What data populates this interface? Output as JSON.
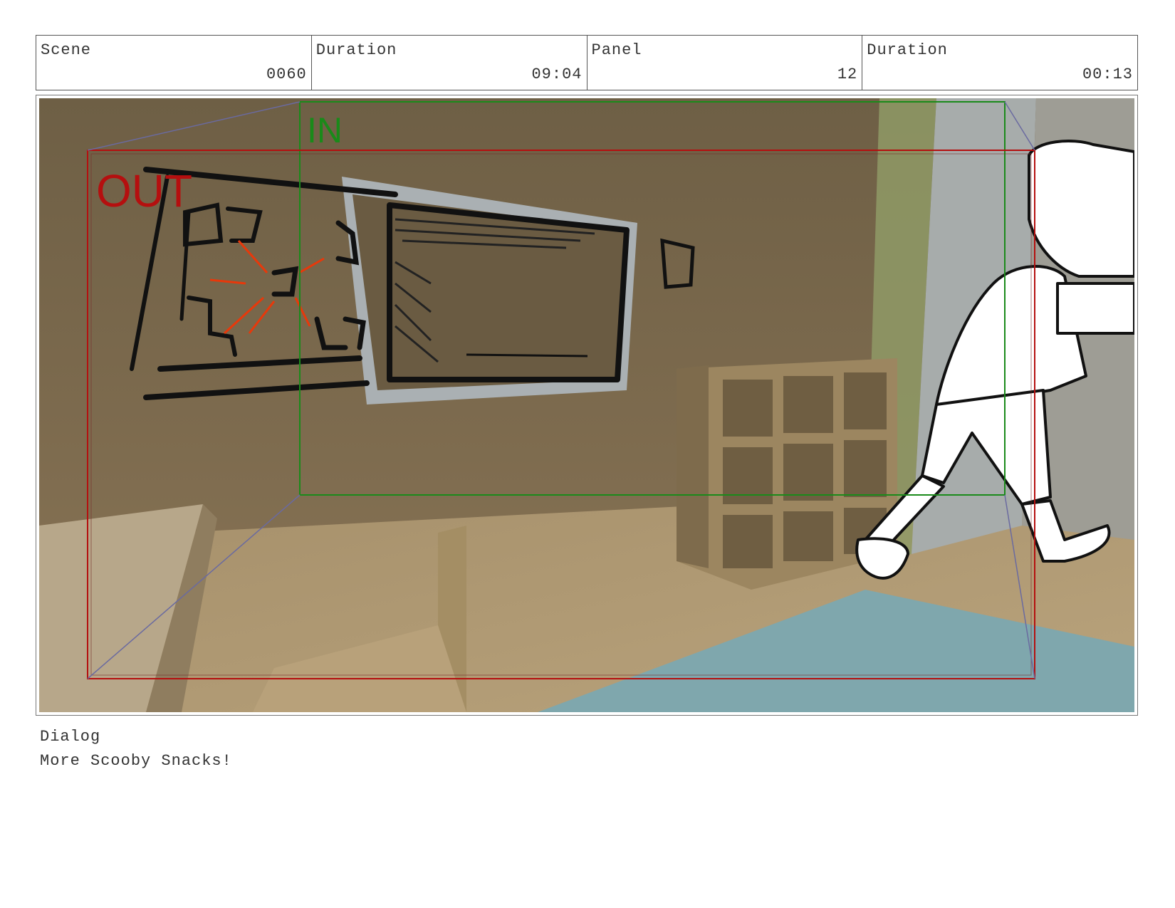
{
  "header": {
    "scene": {
      "label": "Scene",
      "value": "0060"
    },
    "scene_duration": {
      "label": "Duration",
      "value": "09:04"
    },
    "panel": {
      "label": "Panel",
      "value": "12"
    },
    "panel_duration": {
      "label": "Duration",
      "value": "00:13"
    }
  },
  "frame": {
    "in_label": "IN",
    "out_label": "OUT",
    "in_color": "#1a8a1a",
    "out_color": "#b50f0f"
  },
  "dialog": {
    "label": "Dialog",
    "text": "More Scooby Snacks!"
  }
}
